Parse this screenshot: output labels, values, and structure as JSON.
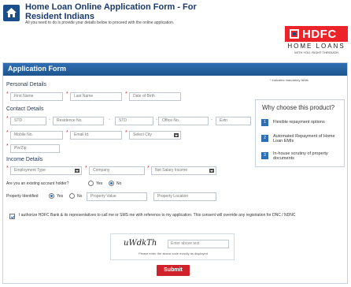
{
  "header": {
    "title_line1": "Home Loan Online Application Form - For",
    "title_line2": "Resident Indians",
    "subtitle": "All you need to do is provide your details below to proceed with the online application."
  },
  "logo": {
    "brand": "HDFC",
    "sub": "HOME LOANS",
    "tagline": "WITH YOU, RIGHT THROUGH",
    "brand_color": "#ed232a"
  },
  "form": {
    "title": "Application Form",
    "mandatory_note": "* indicates mandatory fields",
    "required_mark": "*",
    "dash": "-",
    "personal": {
      "heading": "Personal Details",
      "first_name": "First Name",
      "last_name": "Last Name",
      "dob": "Date of Birth"
    },
    "contact": {
      "heading": "Contact Details",
      "std1": "STD",
      "residence": "Residence No.",
      "std2": "STD",
      "office": "Office No.",
      "extn": "Extn",
      "mobile": "Mobile No.",
      "email": "Email Id.",
      "city": "Select City",
      "pin": "Pin/Zip"
    },
    "income": {
      "heading": "Income Details",
      "employment": "Employment Type",
      "company": "Company",
      "salary": "Net Salary Income",
      "existing_q": "Are you an existing account holder?",
      "yes": "Yes",
      "no": "No",
      "existing_selected": "No",
      "property_q": "Property Identified",
      "property_selected": "Yes",
      "property_value": "Property Value",
      "property_location": "Property Location"
    },
    "consent": "I authorize HDFC Bank & its representatives to call me or SMS me with reference to my application. This consent will override any registration for DNC / NDNC",
    "captcha": {
      "code": "uWdkTh",
      "placeholder": "Enter above text",
      "note": "Please enter the above code exactly as displayed"
    },
    "submit": "Submit"
  },
  "why": {
    "title": "Why choose this product?",
    "items": [
      {
        "num": "1",
        "text": "Flexible repayment options"
      },
      {
        "num": "2",
        "text": "Automated Repayment of Home Loan EMIs"
      },
      {
        "num": "3",
        "text": "In-house scrutiny of property documents"
      }
    ]
  },
  "colors": {
    "accent": "#1d548e",
    "submit": "#d0222a"
  }
}
